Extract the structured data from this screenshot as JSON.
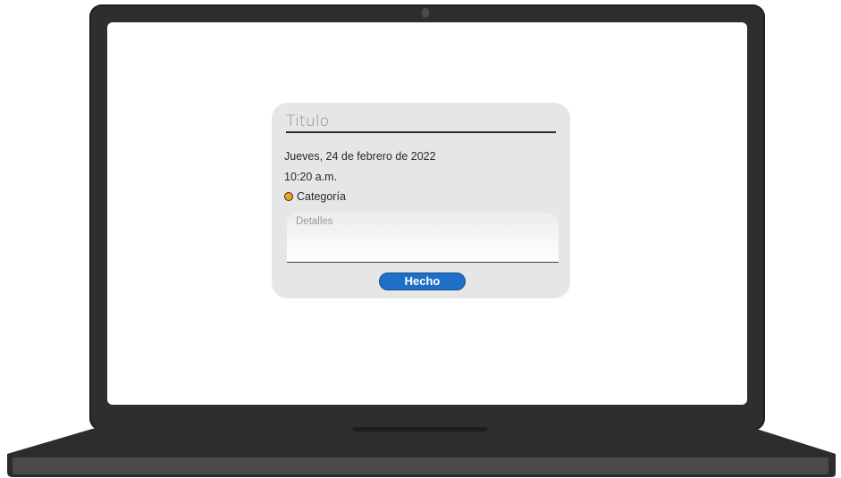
{
  "dialog": {
    "title_placeholder": "Titulo",
    "date": "Jueves, 24 de febrero de 2022",
    "time": "10:20 a.m.",
    "category_label": "Categoría",
    "category_icon": "orange-circle-icon",
    "details_placeholder": "Detalles",
    "done_label": "Hecho"
  },
  "colors": {
    "accent": "#1f6fc8",
    "category": "#f3a11c",
    "card_bg": "#e6e6e6",
    "laptop_frame": "#2e2e2e"
  }
}
